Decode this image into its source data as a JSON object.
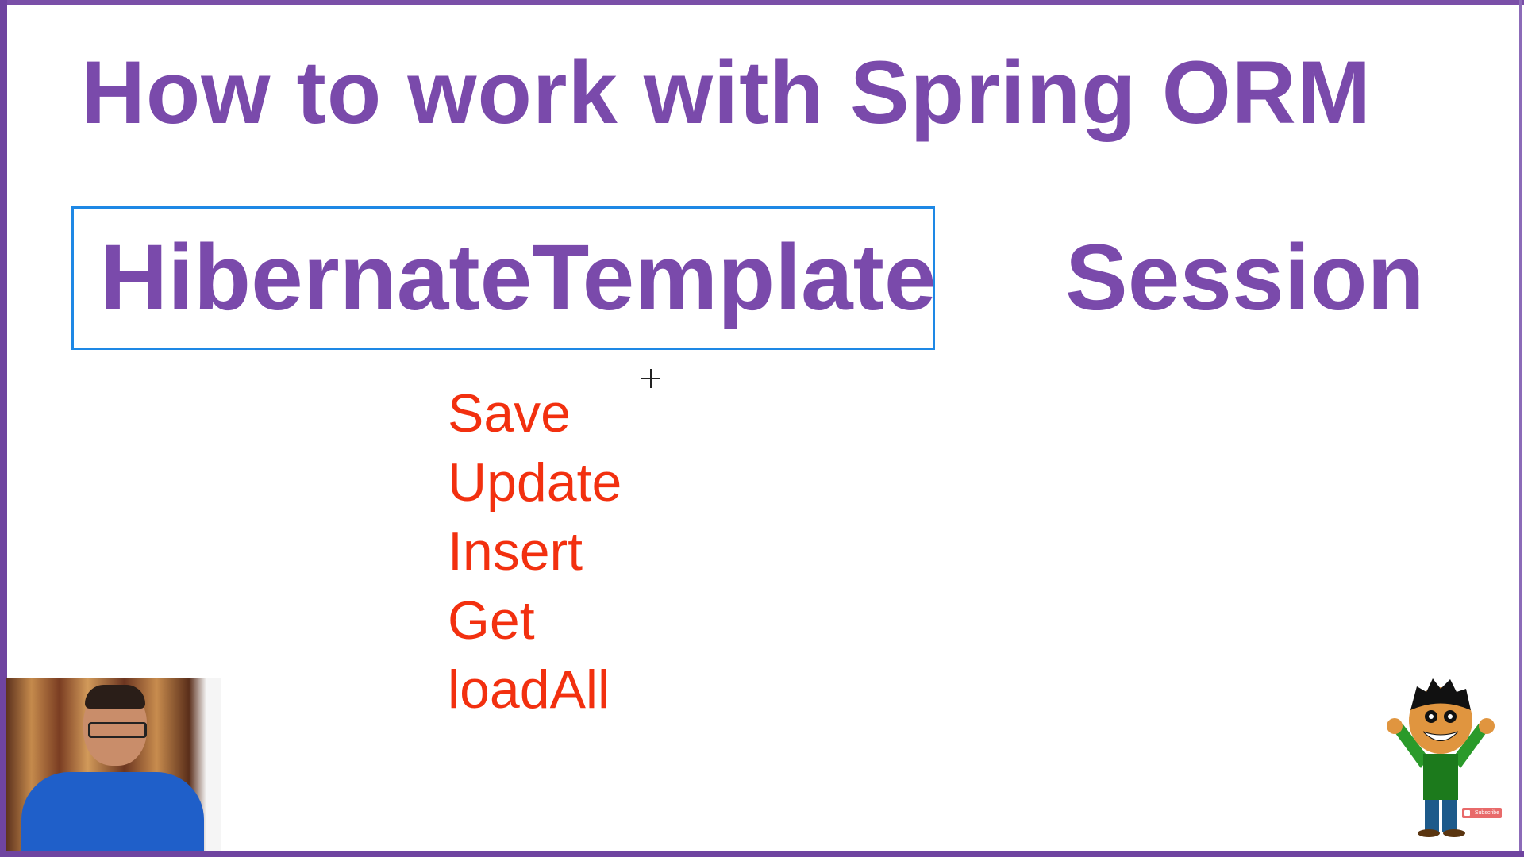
{
  "slide": {
    "title": "How to work with Spring ORM",
    "boxed_term": "HibernateTemplate",
    "second_term": "Session",
    "methods": [
      "Save",
      "Update",
      "Insert",
      "Get",
      "loadAll"
    ]
  },
  "overlay": {
    "subscribe_label": "Subscribe"
  },
  "colors": {
    "title": "#7a4aab",
    "methods": "#f2300f",
    "box_border": "#1e88e5",
    "frame": "#6f44a0"
  }
}
